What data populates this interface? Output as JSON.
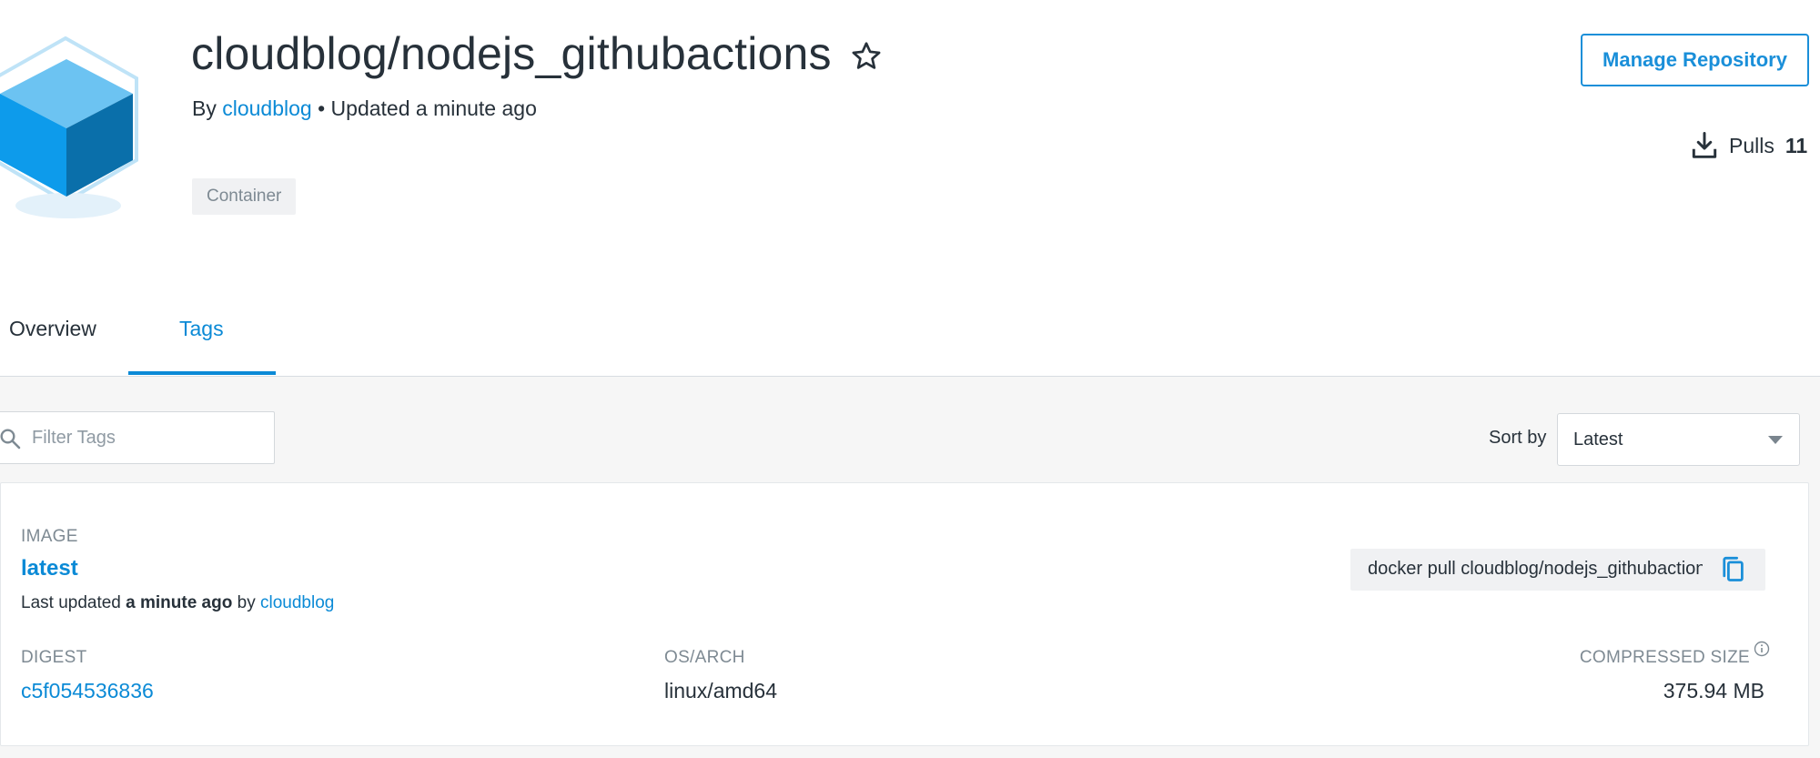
{
  "repo": {
    "title": "cloudblog/nodejs_githubactions",
    "by_prefix": "By",
    "owner": "cloudblog",
    "updated": "• Updated a minute ago",
    "badge": "Container",
    "manage_label": "Manage Repository",
    "pulls_label": "Pulls",
    "pulls_count": "11"
  },
  "tabs": [
    {
      "label": "Overview",
      "active": false
    },
    {
      "label": "Tags",
      "active": true
    }
  ],
  "filter": {
    "placeholder": "Filter Tags"
  },
  "sort": {
    "label": "Sort by",
    "selected": "Latest"
  },
  "image": {
    "section_label": "IMAGE",
    "tag": "latest",
    "updated_prefix": "Last updated",
    "updated_time": "a minute ago",
    "updated_by": "by",
    "updated_user": "cloudblog",
    "pull_command": "docker pull cloudblog/nodejs_githubactions:latest",
    "digest_label": "DIGEST",
    "digest": "c5f054536836",
    "os_label": "OS/ARCH",
    "os": "linux/amd64",
    "size_label": "COMPRESSED SIZE",
    "size": "375.94 MB"
  },
  "colors": {
    "accent": "#0b8ad6",
    "text": "#27313a",
    "muted": "#7e8a93"
  },
  "icons": {
    "repo": "cube-icon",
    "star": "star-icon",
    "download": "download-icon",
    "search": "search-icon",
    "copy": "copy-icon",
    "info": "info-icon",
    "caret": "chevron-down-icon"
  }
}
